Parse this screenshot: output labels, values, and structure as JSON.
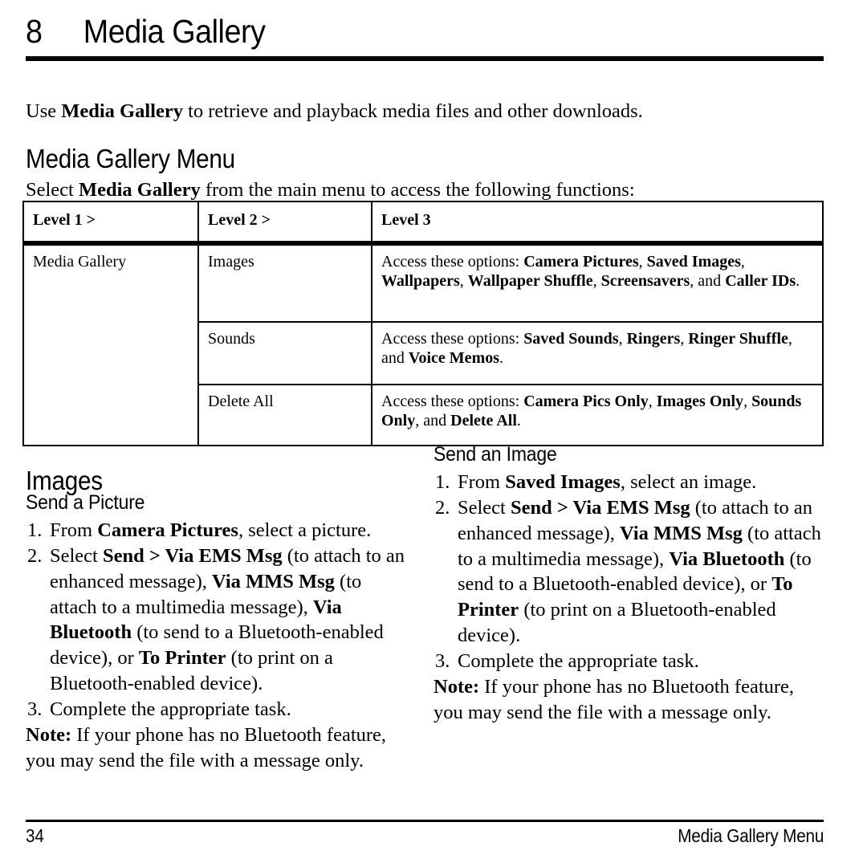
{
  "chapter": {
    "number": "8",
    "title": "Media Gallery"
  },
  "intro": {
    "prefix": "Use ",
    "bold": "Media Gallery",
    "suffix": " to retrieve and playback media files and other downloads."
  },
  "section_menu": {
    "heading": "Media Gallery Menu",
    "lead_prefix": "Select ",
    "lead_bold": "Media Gallery",
    "lead_suffix": " from the main menu to access the following functions:"
  },
  "table": {
    "headers": [
      "Level 1 >",
      "Level 2 >",
      "Level 3"
    ],
    "level1": "Media Gallery",
    "rows": [
      {
        "level2": "Images",
        "level3_prefix": "Access these options: ",
        "level3_items": [
          "Camera Pictures",
          "Saved Images",
          "Wallpapers",
          "Wallpaper Shuffle",
          "Screensavers",
          "Caller IDs"
        ]
      },
      {
        "level2": "Sounds",
        "level3_prefix": "Access these options: ",
        "level3_items": [
          "Saved Sounds",
          "Ringers",
          "Ringer Shuffle",
          "Voice Memos"
        ]
      },
      {
        "level2": "Delete All",
        "level3_prefix": "Access these options: ",
        "level3_items": [
          "Camera Pics Only",
          "Images Only",
          "Sounds Only",
          "Delete All"
        ]
      }
    ]
  },
  "section_images": {
    "heading": "Images",
    "left": {
      "heading": "Send a Picture",
      "steps": [
        {
          "num": "1.",
          "parts": [
            {
              "t": "From ",
              "b": false
            },
            {
              "t": "Camera Pictures",
              "b": true
            },
            {
              "t": ", select a picture.",
              "b": false
            }
          ]
        },
        {
          "num": "2.",
          "parts": [
            {
              "t": "Select ",
              "b": false
            },
            {
              "t": "Send > Via EMS Msg",
              "b": true
            },
            {
              "t": " (to attach to an enhanced message), ",
              "b": false
            },
            {
              "t": "Via MMS Msg",
              "b": true
            },
            {
              "t": " (to attach to a multimedia message), ",
              "b": false
            },
            {
              "t": "Via Bluetooth",
              "b": true
            },
            {
              "t": " (to send to a Bluetooth-enabled device), or ",
              "b": false
            },
            {
              "t": "To Printer",
              "b": true
            },
            {
              "t": " (to print on a Bluetooth-enabled device).",
              "b": false
            }
          ]
        },
        {
          "num": "3.",
          "parts": [
            {
              "t": "Complete the appropriate task.",
              "b": false
            }
          ]
        }
      ],
      "note_label": "Note:",
      "note_text": " If your phone has no Bluetooth feature, you may send the file with a message only."
    },
    "right": {
      "heading": "Send an Image",
      "steps": [
        {
          "num": "1.",
          "parts": [
            {
              "t": "From ",
              "b": false
            },
            {
              "t": "Saved Images",
              "b": true
            },
            {
              "t": ", select an image.",
              "b": false
            }
          ]
        },
        {
          "num": "2.",
          "parts": [
            {
              "t": "Select ",
              "b": false
            },
            {
              "t": "Send > Via EMS Msg",
              "b": true
            },
            {
              "t": " (to attach to an enhanced message), ",
              "b": false
            },
            {
              "t": "Via MMS Msg",
              "b": true
            },
            {
              "t": " (to attach to a multimedia message), ",
              "b": false
            },
            {
              "t": "Via Bluetooth",
              "b": true
            },
            {
              "t": " (to send to a Bluetooth-enabled device), or ",
              "b": false
            },
            {
              "t": "To Printer",
              "b": true
            },
            {
              "t": " (to print on a Bluetooth-enabled device).",
              "b": false
            }
          ]
        },
        {
          "num": "3.",
          "parts": [
            {
              "t": "Complete the appropriate task.",
              "b": false
            }
          ]
        }
      ],
      "note_label": "Note:",
      "note_text": " If your phone has no Bluetooth feature, you may send the file with a message only."
    }
  },
  "footer": {
    "page_number": "34",
    "running_title": "Media Gallery Menu"
  },
  "colors": {
    "text": "#000000",
    "background": "#ffffff",
    "rule": "#000000"
  }
}
